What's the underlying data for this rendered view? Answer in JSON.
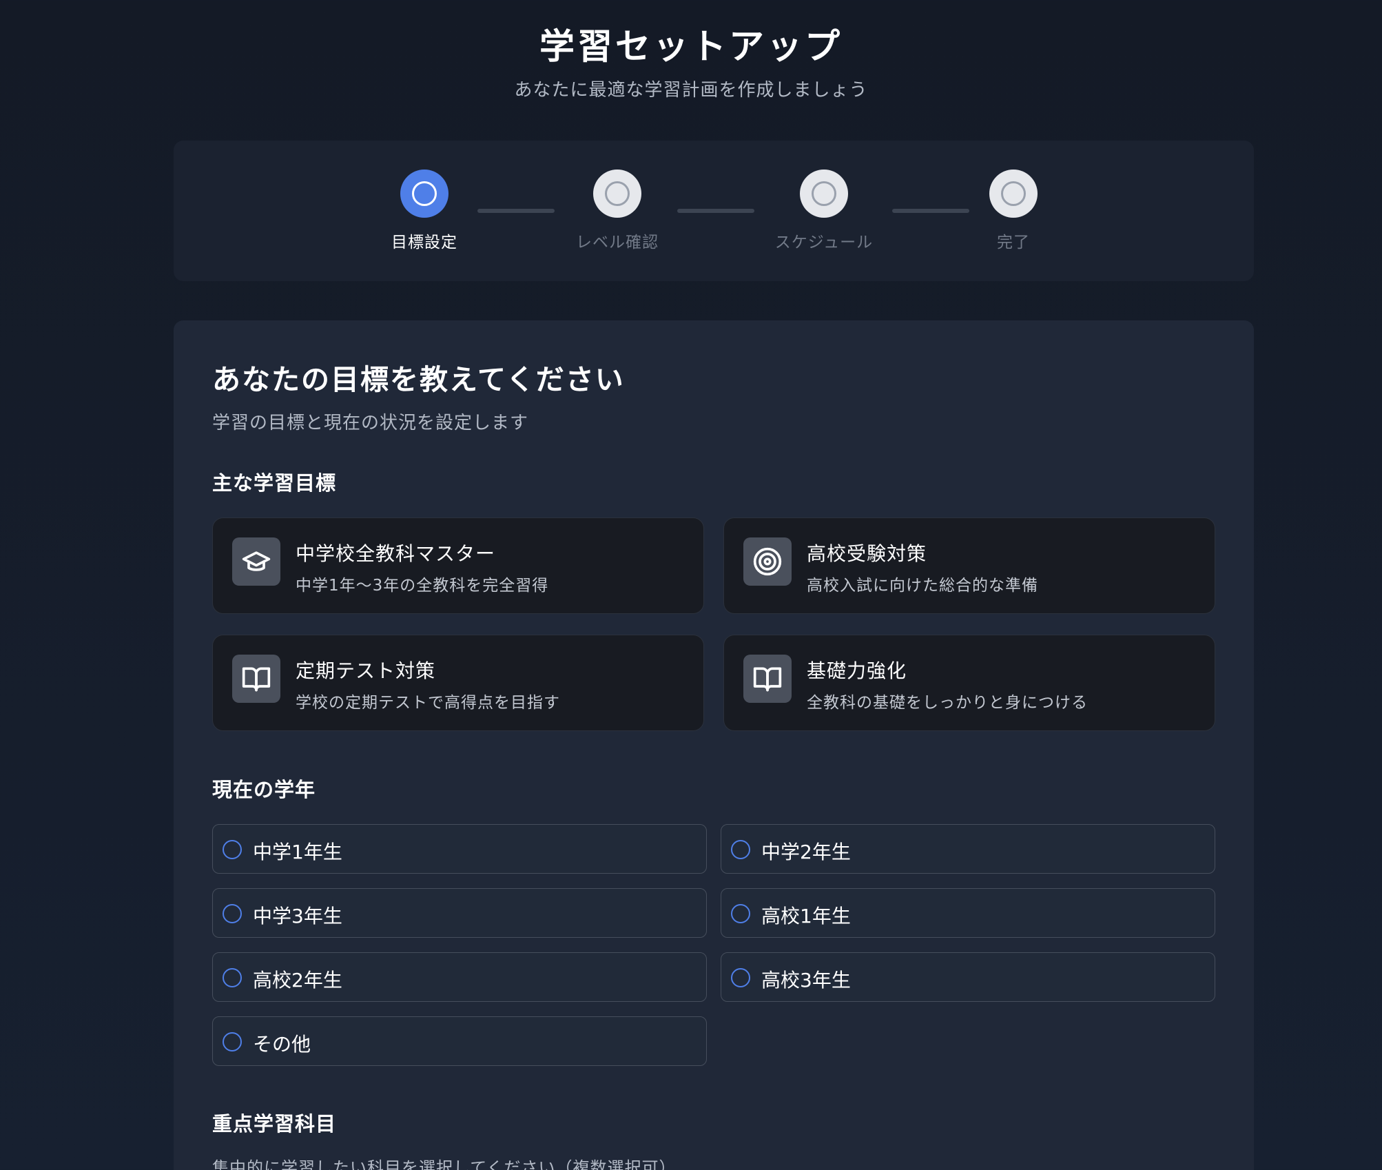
{
  "header": {
    "title": "学習セットアップ",
    "subtitle": "あなたに最適な学習計画を作成しましょう"
  },
  "stepper": {
    "steps": [
      {
        "label": "目標設定",
        "active": true
      },
      {
        "label": "レベル確認",
        "active": false
      },
      {
        "label": "スケジュール",
        "active": false
      },
      {
        "label": "完了",
        "active": false
      }
    ]
  },
  "main": {
    "heading": "あなたの目標を教えてください",
    "subheading": "学習の目標と現在の状況を設定します",
    "goals_section": {
      "title": "主な学習目標",
      "items": [
        {
          "title": "中学校全教科マスター",
          "description": "中学1年〜3年の全教科を完全習得",
          "icon": "graduation-cap-icon"
        },
        {
          "title": "高校受験対策",
          "description": "高校入試に向けた総合的な準備",
          "icon": "target-icon"
        },
        {
          "title": "定期テスト対策",
          "description": "学校の定期テストで高得点を目指す",
          "icon": "book-open-icon"
        },
        {
          "title": "基礎力強化",
          "description": "全教科の基礎をしっかりと身につける",
          "icon": "book-open-icon"
        }
      ]
    },
    "grade_section": {
      "title": "現在の学年",
      "options": [
        "中学1年生",
        "中学2年生",
        "中学3年生",
        "高校1年生",
        "高校2年生",
        "高校3年生",
        "その他"
      ]
    },
    "focus_section": {
      "title": "重点学習科目",
      "hint": "集中的に学習したい科目を選択してください（複数選択可）"
    }
  },
  "colors": {
    "accent": "#4f7fe8",
    "background": "#141a26",
    "card": "#202838"
  }
}
